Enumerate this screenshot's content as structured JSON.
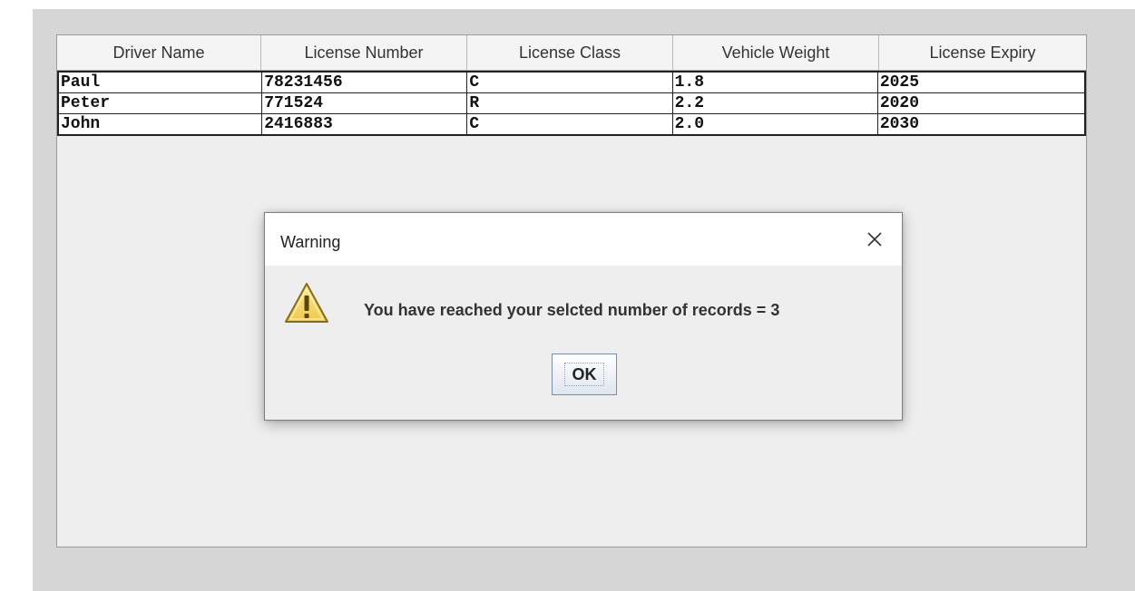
{
  "table": {
    "headers": [
      "Driver Name",
      "License Number",
      "License Class",
      "Vehicle Weight",
      "License Expiry"
    ],
    "rows": [
      [
        "Paul",
        "78231456",
        "C",
        "1.8",
        "2025"
      ],
      [
        "Peter",
        "771524",
        "R",
        "2.2",
        "2020"
      ],
      [
        "John",
        "2416883",
        "C",
        "2.0",
        "2030"
      ]
    ]
  },
  "dialog": {
    "title": "Warning",
    "message": "You have reached your selcted number of records = 3",
    "ok_label": "OK",
    "icons": {
      "warning": "warning-triangle-icon",
      "close": "close-icon"
    }
  },
  "colors": {
    "frame_background": "#d6d6d6",
    "panel_background": "#eeeeee",
    "warning_fill": "#f5d66e",
    "warning_border": "#8a6d12"
  }
}
